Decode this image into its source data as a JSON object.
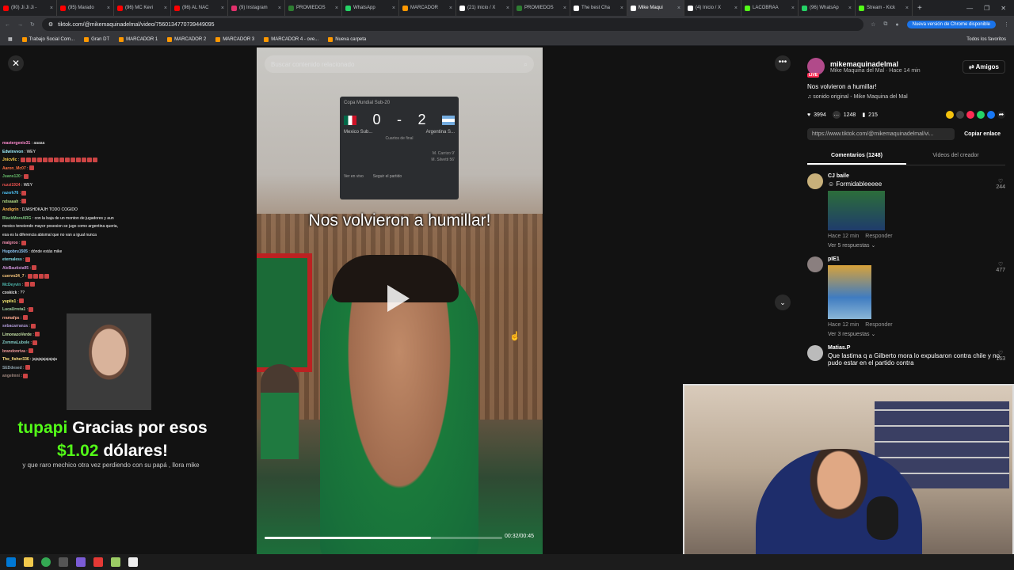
{
  "browser": {
    "tabs": [
      {
        "label": "(90) Ji Ji Ji -",
        "color": "#ff0000"
      },
      {
        "label": "(95) Marado",
        "color": "#ff0000"
      },
      {
        "label": "(96) MC Kevi",
        "color": "#ff0000"
      },
      {
        "label": "(96) AL NAC",
        "color": "#ff0000"
      },
      {
        "label": "(9) Instagram",
        "color": "#e1306c"
      },
      {
        "label": "PROMIEDOS",
        "color": "#2e7d32"
      },
      {
        "label": "WhatsApp",
        "color": "#25d366"
      },
      {
        "label": "MARCADOR",
        "color": "#ff9800"
      },
      {
        "label": "(21) Inicio / X",
        "color": "#ffffff"
      },
      {
        "label": "PROMIEDOS",
        "color": "#2e7d32"
      },
      {
        "label": "The best Cha",
        "color": "#ffffff"
      },
      {
        "label": "Mike Maqui",
        "color": "#ffffff",
        "active": true
      },
      {
        "label": "(4) Inicio / X",
        "color": "#ffffff"
      },
      {
        "label": "LACOBRAA",
        "color": "#53fc18"
      },
      {
        "label": "(96) WhatsAp",
        "color": "#25d366"
      },
      {
        "label": "Stream - Kick",
        "color": "#53fc18"
      }
    ],
    "url": "tiktok.com/@mikemaquinadelmal/video/7560134770739449095",
    "update_label": "Nueva versión de Chrome disponible",
    "bookmarks": [
      "Trabajo Social Com...",
      "Gran DT",
      "MARCADOR 1",
      "MARCADOR 2",
      "MARCADOR 3",
      "MARCADOR 4 - ove...",
      "Nueva carpeta"
    ],
    "all_bookmarks": "Todos los favoritos"
  },
  "video": {
    "search_placeholder": "Buscar contenido relacionado",
    "caption": "Nos volvieron a humillar!",
    "time": "00:32/00:45",
    "progress": 0.7,
    "scorecard": {
      "competition": "Copa Mundial Sub-20",
      "home_score": "0",
      "separator": "-",
      "away_score": "2",
      "home_team": "Mexico Sub...",
      "away_team": "Argentina S...",
      "phase": "Cuartos de final",
      "scorers": [
        "M. Carrizo 9'",
        "M. Silvetti 56'"
      ],
      "watch_label": "Ver en vivo",
      "follow_label": "Seguir el partido"
    }
  },
  "post": {
    "username": "mikemaquinadelmal",
    "subline": "Mike Maquina del Mal · Hace 14 min",
    "live_badge": "LIVE",
    "friends_button": "Amigos",
    "title": "Nos volvieron a humillar!",
    "sound": "sonido original - Mike Maquina del Mal",
    "likes": "3994",
    "comments": "1248",
    "saves": "215",
    "link": "https://www.tiktok.com/@mikemaquinadelmal/vi...",
    "copy_label": "Copiar enlace",
    "tabs": [
      "Comentarios (1248)",
      "Videos del creador"
    ]
  },
  "comments": [
    {
      "user": "CJ baile",
      "text": "Formidableeeee",
      "time": "Hace 12 min",
      "reply": "Responder",
      "replies": "Ver 5 respuestas",
      "likes": "244",
      "has_image": true
    },
    {
      "user": "pIE1",
      "text": "",
      "time": "Hace 12 min",
      "reply": "Responder",
      "replies": "Ver 3 respuestas",
      "likes": "477",
      "has_image": true
    },
    {
      "user": "Matias.P",
      "text": "Que lastima q a Gilberto mora lo expulsaron contra chile y no pudo estar en el partido contra",
      "likes": "163"
    }
  ],
  "chat": [
    {
      "user": "mastergenio31",
      "msg": "aaaaa",
      "color": "#ff8bd0"
    },
    {
      "user": "Edwinvvon",
      "msg": "WEY",
      "color": "#9ef0ff"
    },
    {
      "user": "Jnicvllc",
      "msg": "",
      "color": "#ffd54f",
      "emotes": 14
    },
    {
      "user": "Aaron_Mc07",
      "msg": "",
      "color": "#ff7043",
      "emotes": 1
    },
    {
      "user": "Juans120",
      "msg": "",
      "color": "#66bb6a",
      "emotes": 1
    },
    {
      "user": "ruzzi1924",
      "msg": "WEY",
      "color": "#ef5350"
    },
    {
      "user": "razerk76",
      "msg": "",
      "color": "#4fc3f7",
      "emotes": 1
    },
    {
      "user": "ndsaaah",
      "msg": "",
      "color": "#aed581",
      "emotes": 1
    },
    {
      "user": "Andigrin",
      "msg": "DJASHDKAJH TODO COGIDO",
      "color": "#ffb74d"
    },
    {
      "user": "BlackMoreARG",
      "msg": "con la baja de un monton de jugadores y aun",
      "color": "#81c784"
    },
    {
      "user": "",
      "msg": "mexico teneiendo mayor posesion se jugo como argentina queria,",
      "color": "#81c784"
    },
    {
      "user": "",
      "msg": "esa es la diferencia abismal que no van a igual nunca",
      "color": "#81c784"
    },
    {
      "user": "malgroo",
      "msg": "",
      "color": "#f48fb1",
      "emotes": 1
    },
    {
      "user": "Hugobru1505",
      "msg": "dónde estás mike",
      "color": "#90caf9"
    },
    {
      "user": "eternaless",
      "msg": "",
      "color": "#80deea",
      "emotes": 1
    },
    {
      "user": "AleBautista95",
      "msg": "",
      "color": "#ce93d8",
      "emotes": 1
    },
    {
      "user": "cuervo24_7",
      "msg": "",
      "color": "#ffcc80",
      "emotes": 4
    },
    {
      "user": "McDeyvin",
      "msg": "",
      "color": "#4db6ac",
      "emotes": 2
    },
    {
      "user": "coskick",
      "msg": "??",
      "color": "#e0e0e0"
    },
    {
      "user": "yupiis1",
      "msg": "",
      "color": "#fff176",
      "emotes": 1
    },
    {
      "user": "LucaUrreta1",
      "msg": "",
      "color": "#a5d6a7",
      "emotes": 1
    },
    {
      "user": "rramafps",
      "msg": "",
      "color": "#ffab91",
      "emotes": 1
    },
    {
      "user": "sebacarranza",
      "msg": "",
      "color": "#b39ddb",
      "emotes": 1
    },
    {
      "user": "LimonazoVerde",
      "msg": "",
      "color": "#c5e1a5",
      "emotes": 1
    },
    {
      "user": "ZommaLubole",
      "msg": "",
      "color": "#80cbc4",
      "emotes": 1
    },
    {
      "user": "brandonriva",
      "msg": "",
      "color": "#ef9a9a",
      "emotes": 1
    },
    {
      "user": "The_fisher336",
      "msg": "jajajajajajajaja",
      "color": "#ffe082"
    },
    {
      "user": "SEDdesed",
      "msg": "",
      "color": "#90a4ae",
      "emotes": 1
    },
    {
      "user": "angelmni",
      "msg": "",
      "color": "#a1887f",
      "emotes": 1
    }
  ],
  "donation": {
    "name": "tupapi",
    "thanks": "Gracias por esos",
    "amount": "$1.02",
    "currency": "dólares!",
    "message": "y que raro mechico otra vez perdiendo con su papá , llora mike"
  }
}
